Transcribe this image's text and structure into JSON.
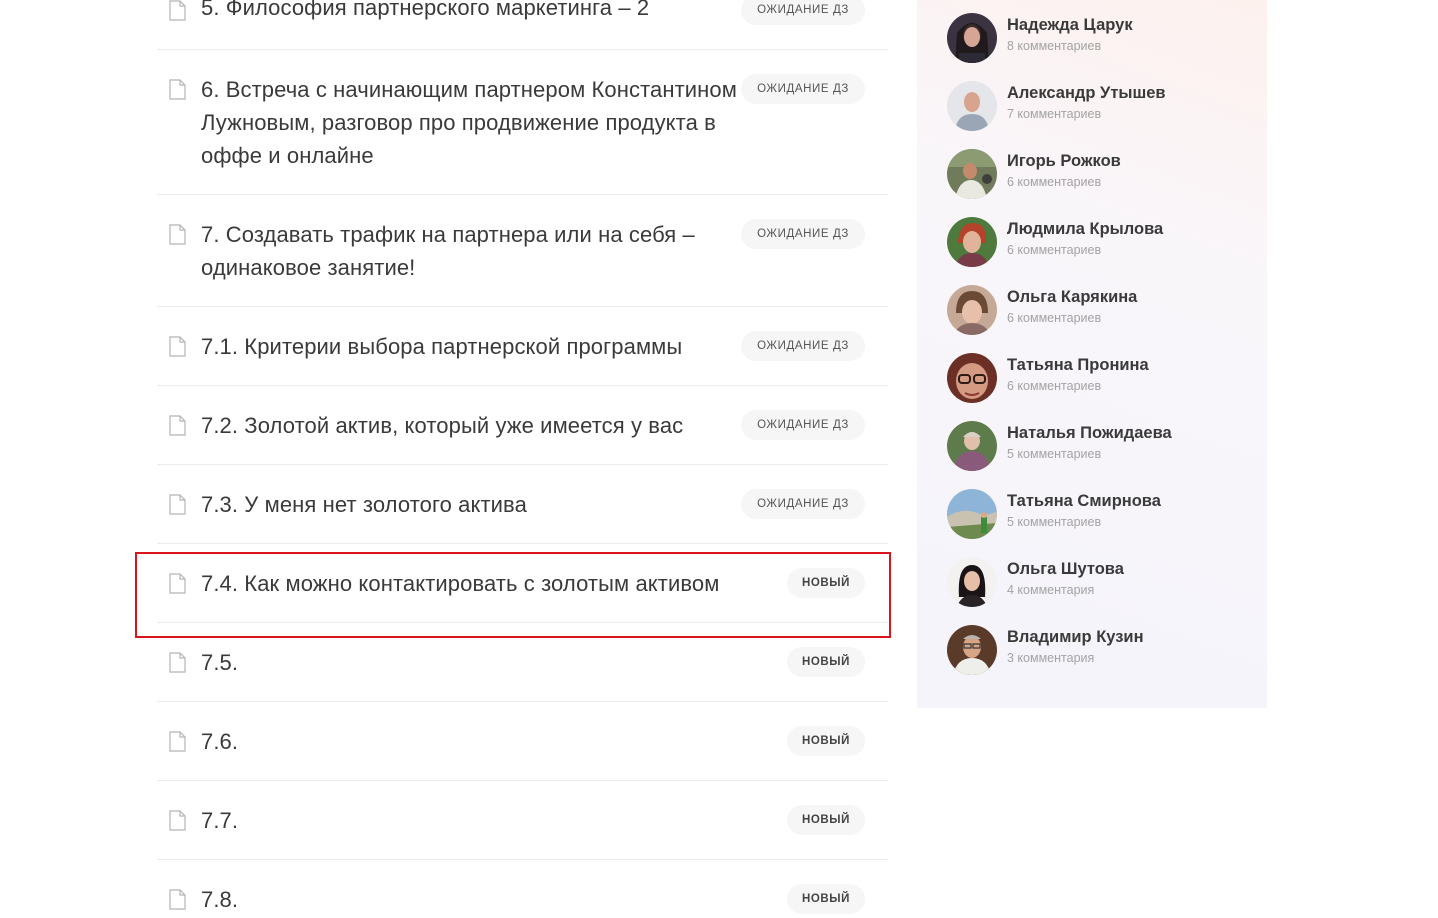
{
  "lessons": [
    {
      "title": "5. Философия партнерского маркетинга – 2",
      "status": "ожидание дз"
    },
    {
      "title": "6. Встреча с начинающим партнером Константином Лужновым, разговор про продвижение продукта в оффе и онлайне",
      "status": "ожидание дз"
    },
    {
      "title": "7. Создавать трафик на партнера или на себя – одинаковое занятие!",
      "status": "ожидание дз"
    },
    {
      "title": "7.1. Критерии выбора партнерской программы",
      "status": "ожидание дз"
    },
    {
      "title": "7.2. Золотой актив, который уже имеется у вас",
      "status": "ожидание дз"
    },
    {
      "title": "7.3. У меня нет золотого актива",
      "status": "ожидание дз"
    },
    {
      "title": "7.4. Как можно контактировать с золотым активом",
      "status": "новый"
    },
    {
      "title": "7.5.",
      "status": "новый"
    },
    {
      "title": "7.6.",
      "status": "новый"
    },
    {
      "title": "7.7.",
      "status": "новый"
    },
    {
      "title": "7.8.",
      "status": "новый"
    }
  ],
  "commenters": [
    {
      "name": "Надежда Царук",
      "count": "8 комментариев"
    },
    {
      "name": "Александр Утышев",
      "count": "7 комментариев"
    },
    {
      "name": "Игорь Рожков",
      "count": "6 комментариев"
    },
    {
      "name": "Людмила Крылова",
      "count": "6 комментариев"
    },
    {
      "name": "Ольга Карякина",
      "count": "6 комментариев"
    },
    {
      "name": "Татьяна Пронина",
      "count": "6 комментариев"
    },
    {
      "name": "Наталья Пожидаева",
      "count": "5 комментариев"
    },
    {
      "name": "Татьяна Смирнова",
      "count": "5 комментариев"
    },
    {
      "name": "Ольга Шутова",
      "count": "4 комментария"
    },
    {
      "name": "Владимир Кузин",
      "count": "3 комментария"
    }
  ],
  "colors": {
    "highlight_border": "#d9141a",
    "badge_bg": "#f6f6f6",
    "divider": "#ececec"
  }
}
